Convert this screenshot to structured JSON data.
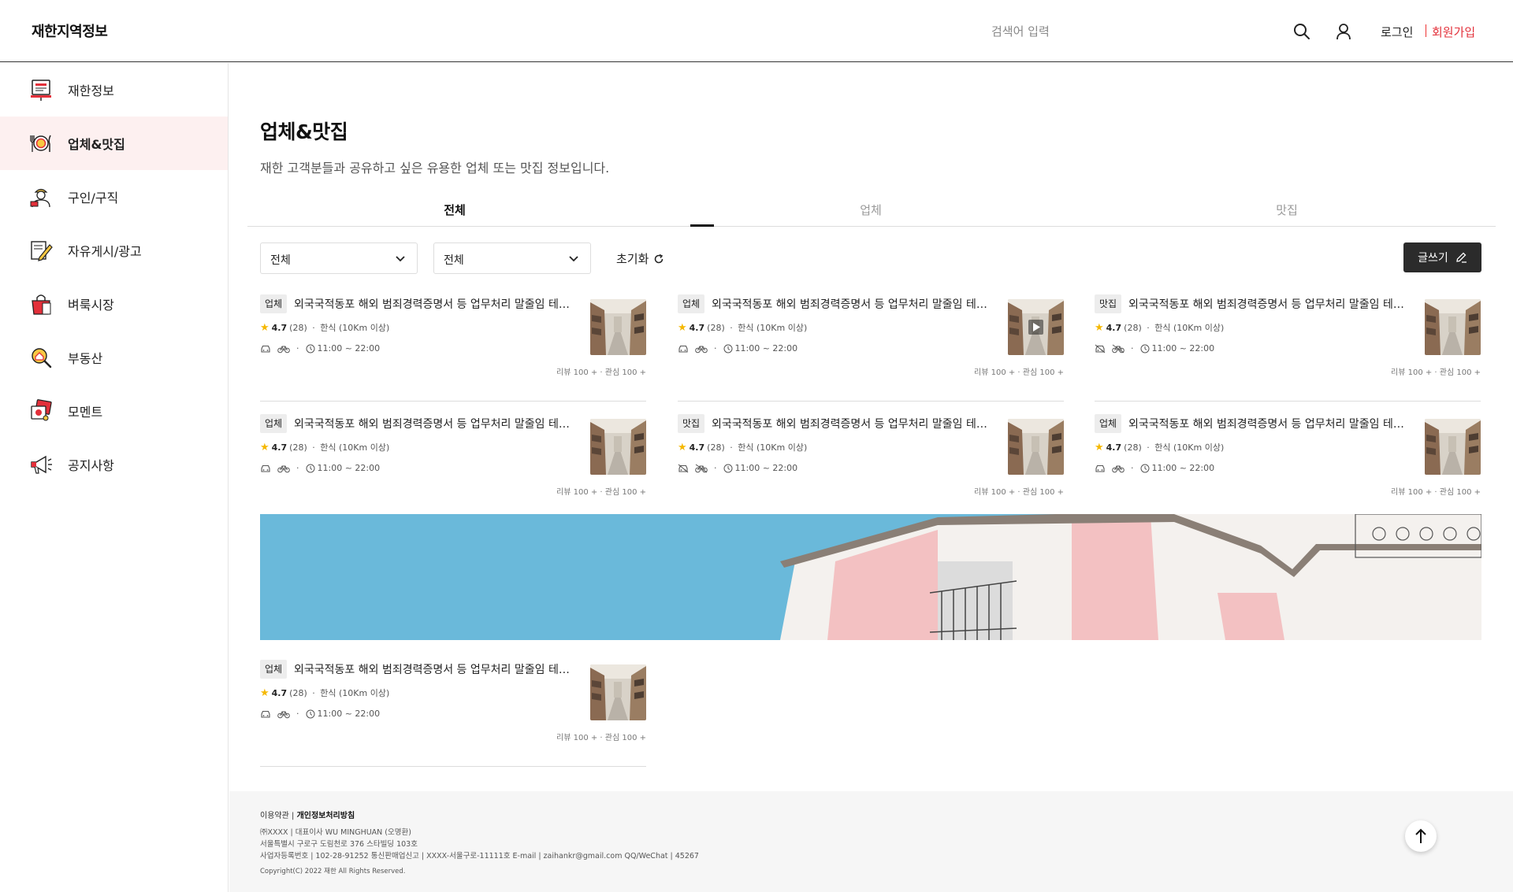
{
  "header": {
    "logo": "재한지역정보",
    "search_placeholder": "검색어 입력",
    "login": "로그인",
    "signup": "회원가입"
  },
  "sidebar": {
    "items": [
      {
        "label": "재한정보",
        "icon": "monitor-icon"
      },
      {
        "label": "업체&맛집",
        "icon": "plate-utensils-icon"
      },
      {
        "label": "구인/구직",
        "icon": "worker-icon"
      },
      {
        "label": "자유게시/광고",
        "icon": "note-pencil-icon"
      },
      {
        "label": "벼룩시장",
        "icon": "shopping-bag-icon"
      },
      {
        "label": "부동산",
        "icon": "house-search-icon"
      },
      {
        "label": "모멘트",
        "icon": "photo-cards-icon"
      },
      {
        "label": "공지사항",
        "icon": "megaphone-icon"
      }
    ],
    "active_index": 1
  },
  "main": {
    "title": "업체&맛집",
    "description": "재한 고객분들과 공유하고 싶은 유용한 업체 또는 맛집 정보입니다.",
    "tabs": [
      "전체",
      "업체",
      "맛집"
    ],
    "active_tab": 0,
    "filters": [
      "전체",
      "전체"
    ],
    "reset_label": "초기화",
    "write_label": "글쓰기"
  },
  "cards": [
    {
      "badge": "업체",
      "title": "외국국적동포 해외 범죄경력증명서 등 업무처리 말줄임 테스트",
      "rating": "4.7",
      "count": "(28)",
      "category": "한식 (10Km 이상)",
      "hours": "11:00 ~ 22:00",
      "stats": "리뷰 100 + · 관심 100 +",
      "video": false,
      "car_off": false
    },
    {
      "badge": "업체",
      "title": "외국국적동포 해외 범죄경력증명서 등 업무처리 말줄임 테스트",
      "rating": "4.7",
      "count": "(28)",
      "category": "한식 (10Km 이상)",
      "hours": "11:00 ~ 22:00",
      "stats": "리뷰 100 + · 관심 100 +",
      "video": true,
      "car_off": false
    },
    {
      "badge": "맛집",
      "title": "외국국적동포 해외 범죄경력증명서 등 업무처리 말줄임 테스트",
      "rating": "4.7",
      "count": "(28)",
      "category": "한식 (10Km 이상)",
      "hours": "11:00 ~ 22:00",
      "stats": "리뷰 100 + · 관심 100 +",
      "video": false,
      "car_off": true
    },
    {
      "badge": "업체",
      "title": "외국국적동포 해외 범죄경력증명서 등 업무처리 말줄임 테스트",
      "rating": "4.7",
      "count": "(28)",
      "category": "한식 (10Km 이상)",
      "hours": "11:00 ~ 22:00",
      "stats": "리뷰 100 + · 관심 100 +",
      "video": false,
      "car_off": false
    },
    {
      "badge": "맛집",
      "title": "외국국적동포 해외 범죄경력증명서 등 업무처리 말줄임 테스트",
      "rating": "4.7",
      "count": "(28)",
      "category": "한식 (10Km 이상)",
      "hours": "11:00 ~ 22:00",
      "stats": "리뷰 100 + · 관심 100 +",
      "video": false,
      "car_off": true
    },
    {
      "badge": "업체",
      "title": "외국국적동포 해외 범죄경력증명서 등 업무처리 말줄임 테스트",
      "rating": "4.7",
      "count": "(28)",
      "category": "한식 (10Km 이상)",
      "hours": "11:00 ~ 22:00",
      "stats": "리뷰 100 + · 관심 100 +",
      "video": false,
      "car_off": false
    },
    {
      "badge": "업체",
      "title": "외국국적동포 해외 범죄경력증명서 등 업무처리 말줄임 테스트",
      "rating": "4.7",
      "count": "(28)",
      "category": "한식 (10Km 이상)",
      "hours": "11:00 ~ 22:00",
      "stats": "리뷰 100 + · 관심 100 +",
      "video": false,
      "car_off": false
    }
  ],
  "footer": {
    "terms": "이용약관",
    "privacy": "개인정보처리방침",
    "line1": "㈜XXXX  |  대표이사 WU MINGHUAN (오명환)",
    "line2": "서울특별시 구로구 도림천로 376 스타빌딩 103호",
    "line3": "사업자등록번호 | 102-28-91252     통신판매업신고 | XXXX-서울구로-11111호     E-mail | zaihankr@gmail.com     QQ/WeChat | 45267",
    "copyright": "Copyright(C) 2022 재한 All Rights Reserved."
  },
  "colors": {
    "accent": "#e3303a",
    "active_bg": "#fdf0f0",
    "button_dark": "#2b2b2b"
  }
}
